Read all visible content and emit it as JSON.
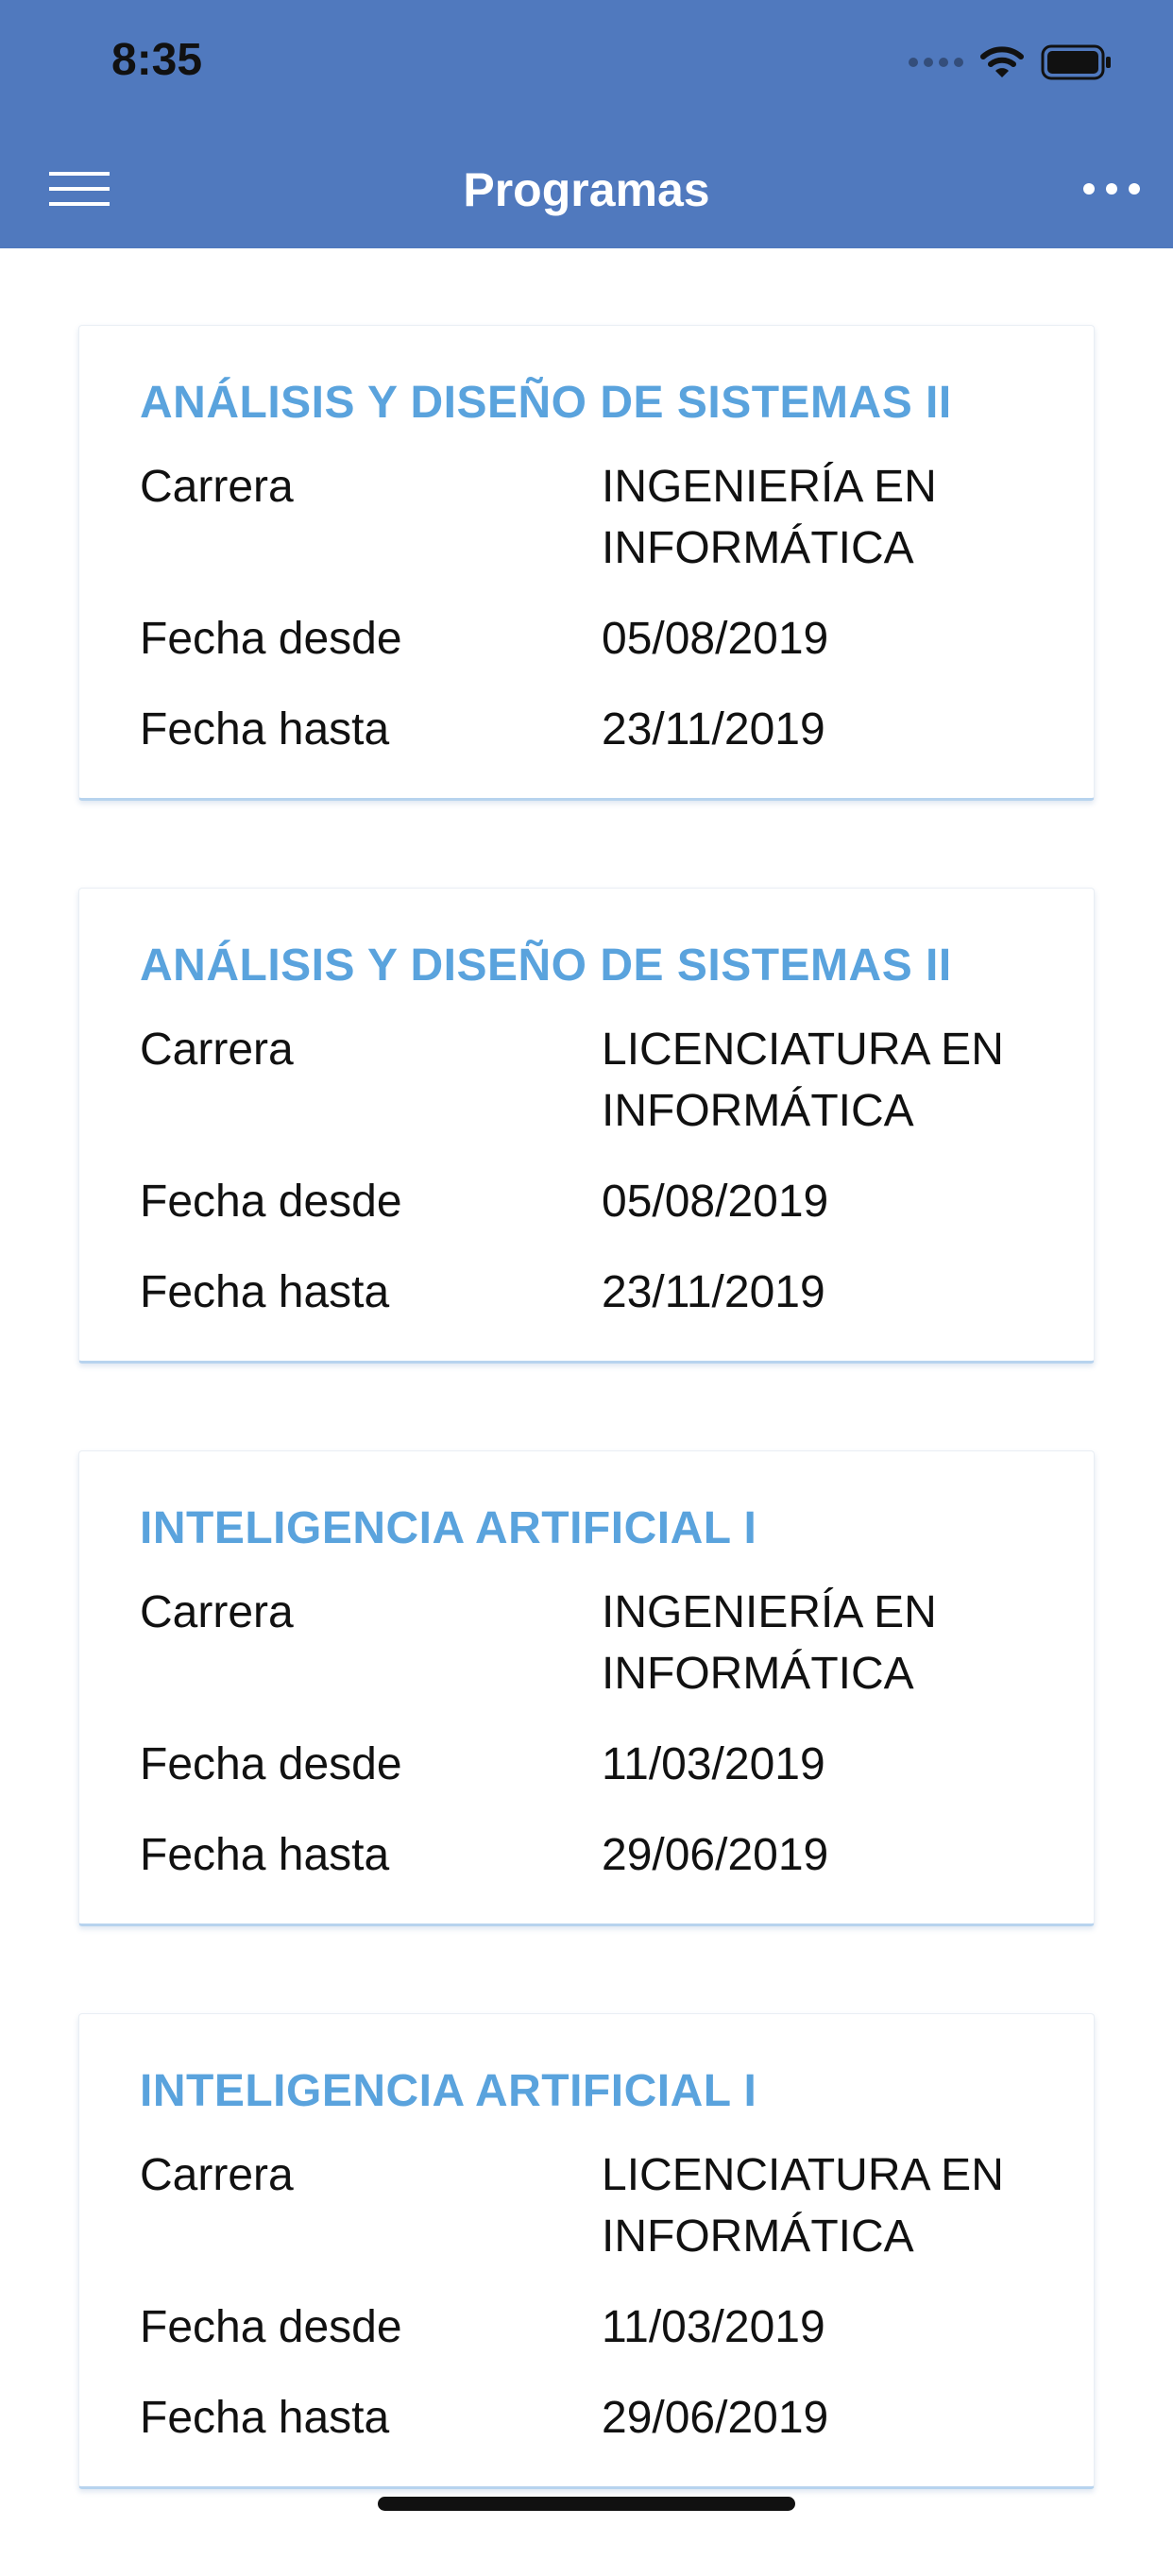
{
  "status_bar": {
    "time": "8:35",
    "icons": [
      "signal-icon",
      "wifi-icon",
      "battery-icon"
    ]
  },
  "header": {
    "title": "Programas",
    "menu_icon": "hamburger-menu-icon",
    "more_icon": "more-options-icon",
    "color": "#5079be"
  },
  "accent_color": "#5aa3dd",
  "programs": [
    {
      "title": "ANÁLISIS Y DISEÑO DE SISTEMAS II",
      "fields": [
        {
          "label": "Carrera",
          "value_lines": [
            "INGENIERÍA EN",
            "INFORMÁTICA"
          ]
        },
        {
          "label": "Fecha desde",
          "value_lines": [
            "05/08/2019"
          ]
        },
        {
          "label": "Fecha hasta",
          "value_lines": [
            "23/11/2019"
          ]
        }
      ]
    },
    {
      "title": "ANÁLISIS Y DISEÑO DE SISTEMAS II",
      "fields": [
        {
          "label": "Carrera",
          "value_lines": [
            "LICENCIATURA EN",
            "INFORMÁTICA"
          ]
        },
        {
          "label": "Fecha desde",
          "value_lines": [
            "05/08/2019"
          ]
        },
        {
          "label": "Fecha hasta",
          "value_lines": [
            "23/11/2019"
          ]
        }
      ]
    },
    {
      "title": "INTELIGENCIA ARTIFICIAL I",
      "fields": [
        {
          "label": "Carrera",
          "value_lines": [
            "INGENIERÍA EN",
            "INFORMÁTICA"
          ]
        },
        {
          "label": "Fecha desde",
          "value_lines": [
            "11/03/2019"
          ]
        },
        {
          "label": "Fecha hasta",
          "value_lines": [
            "29/06/2019"
          ]
        }
      ]
    },
    {
      "title": "INTELIGENCIA ARTIFICIAL I",
      "fields": [
        {
          "label": "Carrera",
          "value_lines": [
            "LICENCIATURA EN",
            "INFORMÁTICA"
          ]
        },
        {
          "label": "Fecha desde",
          "value_lines": [
            "11/03/2019"
          ]
        },
        {
          "label": "Fecha hasta",
          "value_lines": [
            "29/06/2019"
          ]
        }
      ]
    }
  ]
}
